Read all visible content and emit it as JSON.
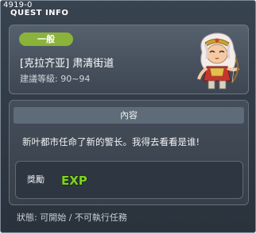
{
  "window": {
    "quest_id": "4919-0",
    "title": "QUEST INFO"
  },
  "quest": {
    "category": "一般",
    "name": "[克拉齐亚] 肃清街道",
    "level": "建議等級: 90~94"
  },
  "content": {
    "header": "內容",
    "description": "新叶都市任命了新的警长。我得去看看是谁!"
  },
  "reward": {
    "label": "獎勵",
    "exp_text": "EXP"
  },
  "status": "狀態: 可開始 / 不可執行任務",
  "colors": {
    "badge": "#8bb23a",
    "exp_fill": "#7ed321",
    "exp_outline": "#1c2a08"
  }
}
